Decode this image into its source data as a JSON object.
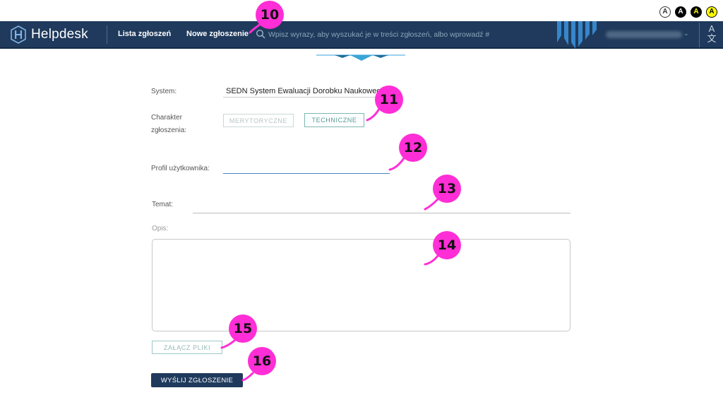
{
  "contrast": {
    "options": [
      "A",
      "A",
      "A",
      "A"
    ],
    "colors": [
      "#ffffff",
      "#000000",
      "#000000",
      "#000000"
    ],
    "text_colors": [
      "#333333",
      "#ffffff",
      "#ffff00",
      "#000000"
    ],
    "bg_last": "#ffff00"
  },
  "navbar": {
    "brand": "Helpdesk",
    "links": {
      "lista": "Lista zgłoszeń",
      "nowe": "Nowe zgłoszenie"
    },
    "search_placeholder": "Wpisz wyrazy, aby wyszukać je w treści zgłoszeń, albo wprowadź #",
    "lang_icon": "A\n文",
    "user_caret": "⌄",
    "colors": {
      "bg": "#1f3a5c",
      "deco": "#3a8fd6"
    }
  },
  "form": {
    "system_label": "System:",
    "system_value": "SEDN System Ewaluacji Dorobku Naukowego",
    "charakter_label": "Charakter zgłoszenia:",
    "charakter_options": [
      "MERYTORYCZNE",
      "TECHNICZNE"
    ],
    "profil_label": "Profil użytkownika:",
    "temat_label": "Temat:",
    "opis_label": "Opis:",
    "attach_label": "ZAŁĄCZ PLIKI",
    "submit_label": "WYŚLIJ ZGŁOSZENIE"
  },
  "markers": [
    "10",
    "11",
    "12",
    "13",
    "14",
    "15",
    "16"
  ],
  "accent_colors": {
    "marker": "#ff2ed6",
    "teal_border": "#7fb6b1",
    "focus_blue": "#4a86c5"
  }
}
